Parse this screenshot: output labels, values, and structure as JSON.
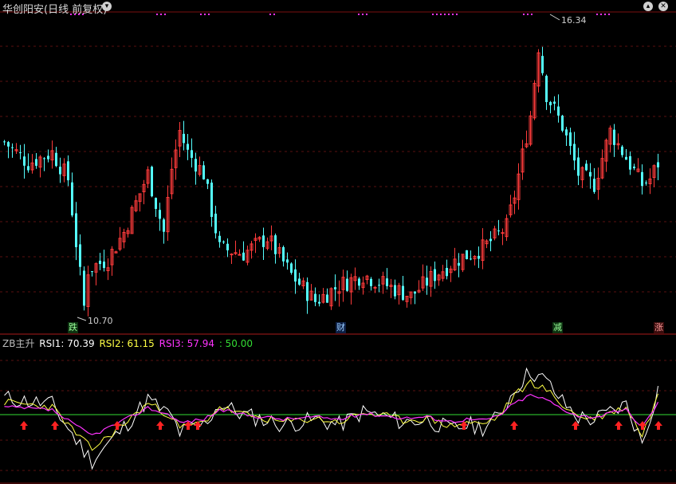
{
  "header": {
    "title": "华创阳安(日线 前复权)",
    "dropdown_icon": "chevron-down-icon",
    "window_buttons": [
      "chevron-up-icon",
      "close-icon"
    ]
  },
  "price_chart": {
    "max_label": "16.34",
    "min_label": "10.70",
    "max_value": 16.34,
    "min_value": 10.7,
    "up_color": "#ff3b3b",
    "down_color": "#54ffff",
    "signal_dot_color": "#ff33ff",
    "tags": [
      {
        "text": "跌",
        "color": "#22aa44"
      },
      {
        "text": "财",
        "color": "#3a78ff"
      },
      {
        "text": "减",
        "color": "#22aa44"
      },
      {
        "text": "涨",
        "color": "#dd2222"
      }
    ]
  },
  "indicator": {
    "name": "ZB主升",
    "rsi1": "RSI1: 70.39",
    "rsi2": "RSI2: 61.15",
    "rsi3": "RSI3: 57.94",
    "level": ": 50.00",
    "rsi1_color": "#ffffff",
    "rsi2_color": "#ffff44",
    "rsi3_color": "#ff33ff",
    "level_color": "#33dd33",
    "arrow_color": "#ff2222"
  }
}
